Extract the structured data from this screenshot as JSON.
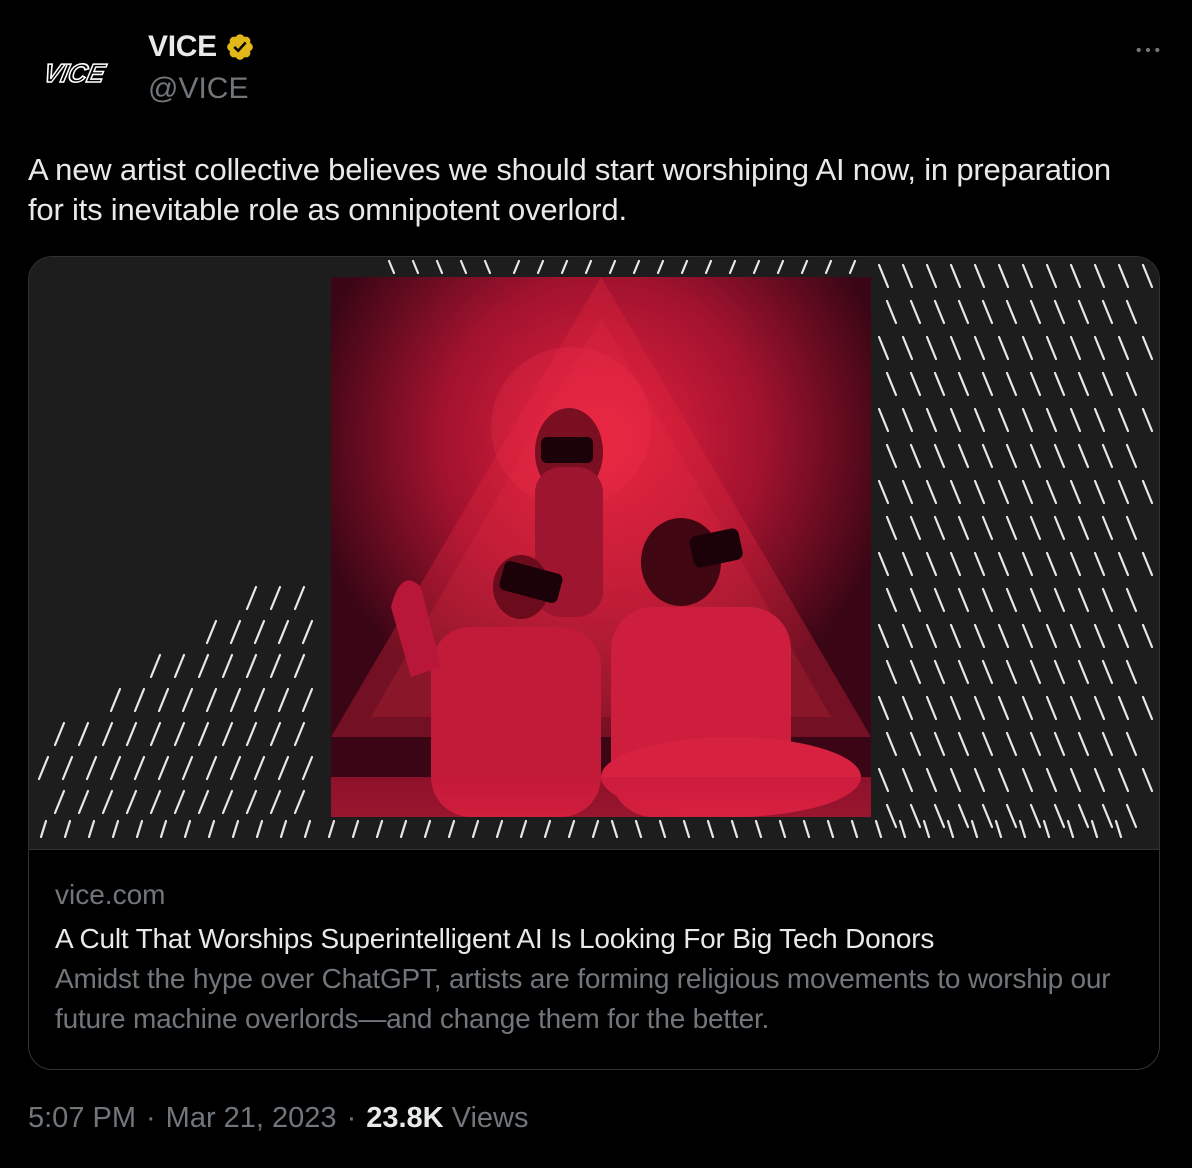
{
  "author": {
    "display_name": "VICE",
    "handle": "@VICE",
    "avatar_text": "VICE",
    "verified_badge_color": "#e2b719"
  },
  "tweet": {
    "text": "A new artist collective believes we should start worshiping AI now, in preparation for its inevitable role as omnipotent overlord."
  },
  "card": {
    "domain": "vice.com",
    "title": "A Cult That Worships Superintelligent AI Is Looking For Big Tech Donors",
    "description": "Amidst the hype over ChatGPT, artists are forming religious movements to worship our future machine overlords—and change them for the better."
  },
  "footer": {
    "time": "5:07 PM",
    "date": "Mar 21, 2023",
    "views_count": "23.8K",
    "views_label": "Views",
    "separator": "·"
  },
  "icons": {
    "more": "more-icon",
    "verified": "verified-badge-icon"
  },
  "colors": {
    "background": "#000000",
    "text_primary": "#e7e9ea",
    "text_secondary": "#71767b",
    "border": "#2f3336",
    "image_red": "#d11c3a"
  }
}
